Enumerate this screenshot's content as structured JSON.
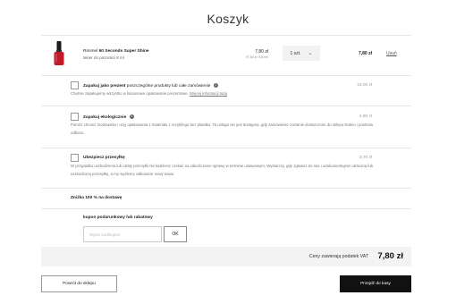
{
  "page": {
    "title": "Koszyk"
  },
  "product": {
    "brand": "Rimmel",
    "name": "60 Seconds Super Shine",
    "subtitle": "lakier do paznokci 8 ml",
    "price": "7,80 zł",
    "unit_price": "97,50 zł / 100 ml",
    "quantity": "1 szt.",
    "total": "7,80 zł",
    "remove_label": "Usuń",
    "thumb_color": "#c01a2b"
  },
  "options": [
    {
      "title_bold": "Zapakuj jako prezent",
      "title_rest": " poszczególne produkty lub całe zamówienie",
      "price": "19,00 zł",
      "desc": "Chętnie zapakujemy wszystko w luksusowe opakowanie prezentowe.",
      "link": "Więcej informacji tutaj"
    },
    {
      "title_bold": "Zapakuj ekologicznie",
      "price": "4,90 zł",
      "desc": "Pomóż chronić środowisko i użyj opakowania z materiału z recyklingu bez plastiku. Ta usługa nie jest dostępna, gdy zamówienie zostanie dostarczone do sklepu Notino i punktów odbioru."
    },
    {
      "title_bold": "Ubezpiecz przesyłkę",
      "price": "3,70 zł",
      "desc": "W przypadku uszkodzenia lub utraty przesyłki nie będziesz czekać na zakończenie sprawy w terminie ustawowym. Wystarczy, gdy zgłosisz do nas i udokumentujesz utraconą lub uszkodzoną przesyłkę, a my wyślemy całkowicie nowy towar."
    }
  ],
  "shipping_discount": "Zniżka 100 % na dostawę",
  "coupon": {
    "label": "kupon podarunkowy lub rabatowy",
    "placeholder": "Wpisz kod/kupon",
    "ok_label": "OK"
  },
  "summary": {
    "vat_label": "Ceny zawierają podatek VAT",
    "total": "7,80 zł"
  },
  "buttons": {
    "back": "Powrót do sklepu",
    "checkout": "Przejdź do kasy"
  }
}
